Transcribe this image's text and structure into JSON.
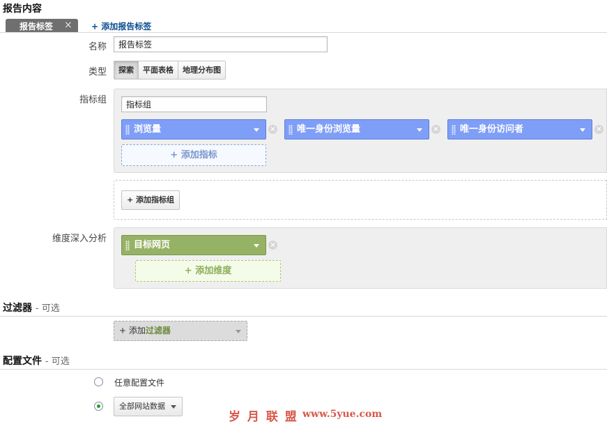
{
  "report_content": {
    "section_title": "报告内容",
    "tab_label": "报告标签",
    "add_tab_label": "+ 添加报告标签",
    "name_label": "名称",
    "name_value": "报告标签",
    "type_label": "类型",
    "type_options": [
      "探索",
      "平面表格",
      "地理分布图"
    ],
    "type_selected": "探索",
    "metric_group_label": "指标组",
    "metric_group_name": "指标组",
    "metrics": [
      "浏览量",
      "唯一身份浏览量",
      "唯一身份访问者"
    ],
    "add_metric_label": "+ 添加指标",
    "add_metric_group_label": "+ 添加指标组",
    "dimension_label": "维度深入分析",
    "dimensions": [
      "目标网页"
    ],
    "add_dimension_label": "+ 添加维度"
  },
  "filters": {
    "section_title": "过滤器",
    "optional_text": "- 可选",
    "add_filter_prefix": "+ 添加",
    "add_filter_emphasis": "过滤器"
  },
  "profiles": {
    "section_title": "配置文件",
    "optional_text": "- 可选",
    "any_profile_label": "任意配置文件",
    "selected_profile": "全部网站数据"
  },
  "watermark": {
    "text_cn": "岁 月 联 盟",
    "text_url": "www.5yue.com"
  },
  "colors": {
    "metric_chip": "#7f9ef7",
    "dimension_chip": "#96b265",
    "link": "#0b4f8f",
    "watermark": "#d8584a"
  }
}
